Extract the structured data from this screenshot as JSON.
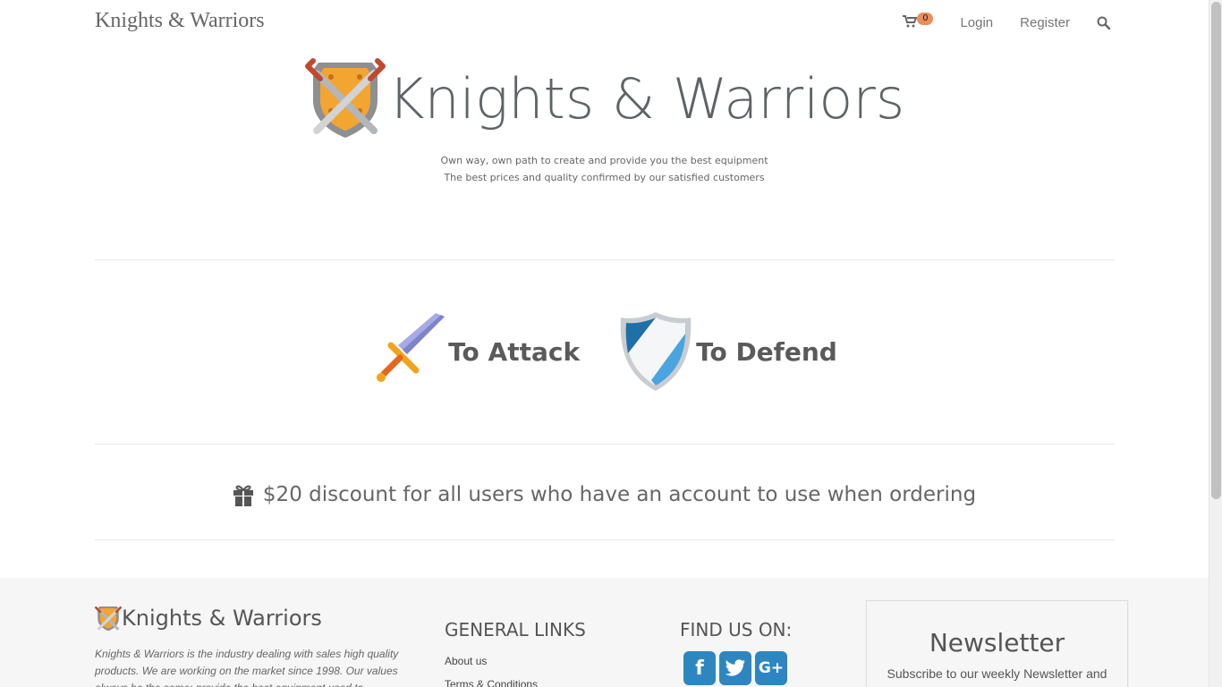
{
  "nav": {
    "brand": "Knights & Warriors",
    "cart_count": "0",
    "login": "Login",
    "register": "Register"
  },
  "hero": {
    "title": "Knights & Warriors",
    "subtitle_1": "Own way, own path to create and provide you the best equipment",
    "subtitle_2": "The best prices and quality confirmed by our satisfied customers"
  },
  "features": {
    "attack": "To Attack",
    "defend": "To Defend"
  },
  "discount": {
    "text": "$20 discount for all users who have an account to use when ordering"
  },
  "footer": {
    "brand": "Knights & Warriors",
    "description": "Knights & Warriors is the industry dealing with sales high quality products. We are working on the market since 1998. Our values always be the same: provide the best equipment used to",
    "general_links_heading": "GENERAL LINKS",
    "links": [
      "About us",
      "Terms & Conditions"
    ],
    "find_us_heading": "FIND US ON:",
    "social": [
      "facebook-icon",
      "twitter-icon",
      "google-plus-icon"
    ],
    "newsletter_title": "Newsletter",
    "newsletter_text": "Subscribe to our weekly Newsletter and"
  },
  "colors": {
    "badge": "#ef8c5a",
    "social": "#2e86c1",
    "footer_bg": "#f6f6f6"
  }
}
